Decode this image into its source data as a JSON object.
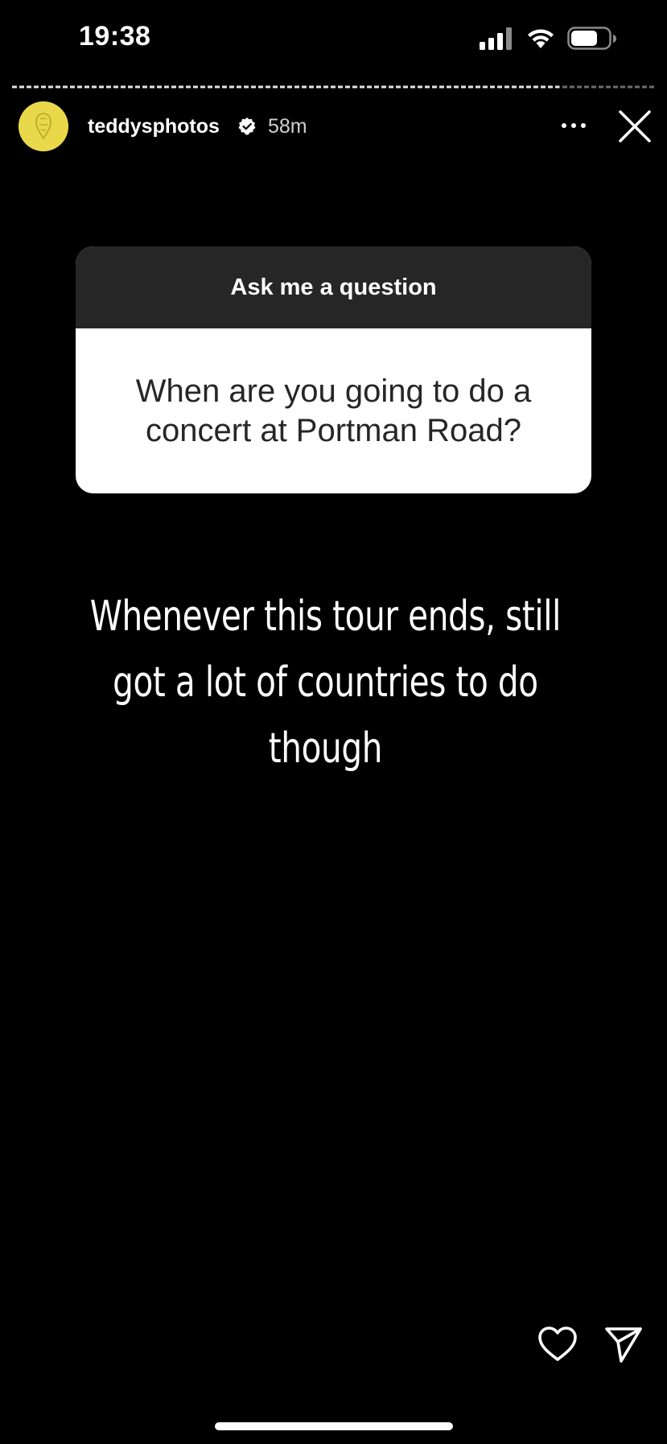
{
  "status_bar": {
    "time": "19:38",
    "signal_icon": "cellular-signal-icon",
    "wifi_icon": "wifi-icon",
    "battery_icon": "battery-icon"
  },
  "story": {
    "progress_fraction": 0.85,
    "header": {
      "username": "teddysphotos",
      "verified": true,
      "time_ago": "58m",
      "more_icon": "more-horizontal-icon",
      "close_icon": "close-icon"
    },
    "question_sticker": {
      "prompt": "Ask me a question",
      "question": "When are you going to do a concert at Portman Road?"
    },
    "answer_text": "Whenever this tour ends, still got a lot of countries to do though",
    "actions": {
      "like_icon": "heart-icon",
      "share_icon": "send-icon"
    }
  },
  "colors": {
    "background": "#000000",
    "card_header": "#262626",
    "card_body": "#ffffff",
    "avatar": "#e8d84a"
  }
}
